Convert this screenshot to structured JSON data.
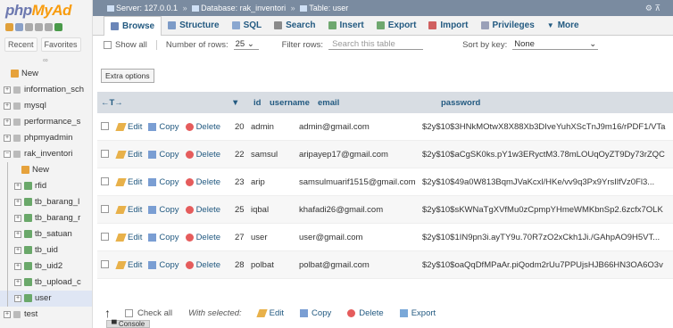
{
  "nav": {
    "logo_php": "php",
    "logo_my": "MyAd",
    "tabs": [
      "Recent",
      "Favorites"
    ],
    "tree": [
      {
        "label": "New",
        "type": "new",
        "level": 0
      },
      {
        "label": "information_sch",
        "type": "db",
        "level": 0
      },
      {
        "label": "mysql",
        "type": "db",
        "level": 0
      },
      {
        "label": "performance_s",
        "type": "db",
        "level": 0
      },
      {
        "label": "phpmyadmin",
        "type": "db",
        "level": 0
      },
      {
        "label": "rak_inventori",
        "type": "db",
        "level": 0,
        "expanded": true
      },
      {
        "label": "New",
        "type": "new",
        "level": 1
      },
      {
        "label": "rfid",
        "type": "table",
        "level": 1
      },
      {
        "label": "tb_barang_l",
        "type": "table",
        "level": 1
      },
      {
        "label": "tb_barang_r",
        "type": "table",
        "level": 1
      },
      {
        "label": "tb_satuan",
        "type": "table",
        "level": 1
      },
      {
        "label": "tb_uid",
        "type": "table",
        "level": 1
      },
      {
        "label": "tb_uid2",
        "type": "table",
        "level": 1
      },
      {
        "label": "tb_upload_c",
        "type": "table",
        "level": 1
      },
      {
        "label": "user",
        "type": "table",
        "level": 1,
        "active": true
      },
      {
        "label": "test",
        "type": "db",
        "level": 0
      }
    ]
  },
  "breadcrumb": {
    "server": "Server: 127.0.0.1",
    "database": "Database: rak_inventori",
    "table": "Table: user"
  },
  "menu": {
    "tabs": [
      {
        "label": "Browse",
        "active": true,
        "color": "#6b86b8"
      },
      {
        "label": "Structure",
        "color": "#7d9bc7"
      },
      {
        "label": "SQL",
        "color": "#8aa7d0"
      },
      {
        "label": "Search",
        "color": "#8a8a8a"
      },
      {
        "label": "Insert",
        "color": "#6fa86f"
      },
      {
        "label": "Export",
        "color": "#6fa86f"
      },
      {
        "label": "Import",
        "color": "#d06060"
      },
      {
        "label": "Privileges",
        "color": "#9aa0b8"
      },
      {
        "label": "More",
        "color": "#235a81"
      }
    ]
  },
  "controls": {
    "show_all": "Show all",
    "number_of_rows_label": "Number of rows:",
    "number_of_rows_value": "25",
    "filter_rows_label": "Filter rows:",
    "filter_placeholder": "Search this table",
    "sort_by_key_label": "Sort by key:",
    "sort_by_key_value": "None"
  },
  "extra_options": "Extra options",
  "table": {
    "arrows": "←T→",
    "columns": [
      "id",
      "username",
      "email",
      "password"
    ],
    "actions": {
      "edit": "Edit",
      "copy": "Copy",
      "delete": "Delete"
    },
    "rows": [
      {
        "id": "20",
        "username": "admin",
        "email": "admin@gmail.com",
        "password": "$2y$10$3HNkMOtwX8X88Xb3DIveYuhXScTnJ9m16/rPDF1/VTa"
      },
      {
        "id": "22",
        "username": "samsul",
        "email": "aripayep17@gmail.com",
        "password": "$2y$10$aCgSK0ks.pY1w3ERyctM3.78mLOUqOyZT9Dy73rZQC"
      },
      {
        "id": "23",
        "username": "arip",
        "email": "samsulmuarif1515@gmail.com",
        "password": "$2y$10$49a0W813BqmJVaKcxl/HKe/vv9q3Px9YrsIlfVz0Fl3..."
      },
      {
        "id": "25",
        "username": "iqbal",
        "email": "khafadi26@gmail.com",
        "password": "$2y$10$sKWNaTgXVfMu0zCpmpYHmeWMKbnSp2.6zcfx7OLK"
      },
      {
        "id": "27",
        "username": "user",
        "email": "user@gmail.com",
        "password": "$2y$10$1IN9pn3i.ayTY9u.70R7zO2xCkh1Ji./GAhpAO9H5VT..."
      },
      {
        "id": "28",
        "username": "polbat",
        "email": "polbat@gmail.com",
        "password": "$2y$10$oaQqDfMPaAr.piQodm2rUu7PPUjsHJB66HN3OA6O3v"
      }
    ]
  },
  "footer": {
    "check_all": "Check all",
    "with_selected": "With selected:",
    "edit": "Edit",
    "copy": "Copy",
    "delete": "Delete",
    "export": "Export"
  },
  "console": "Console"
}
